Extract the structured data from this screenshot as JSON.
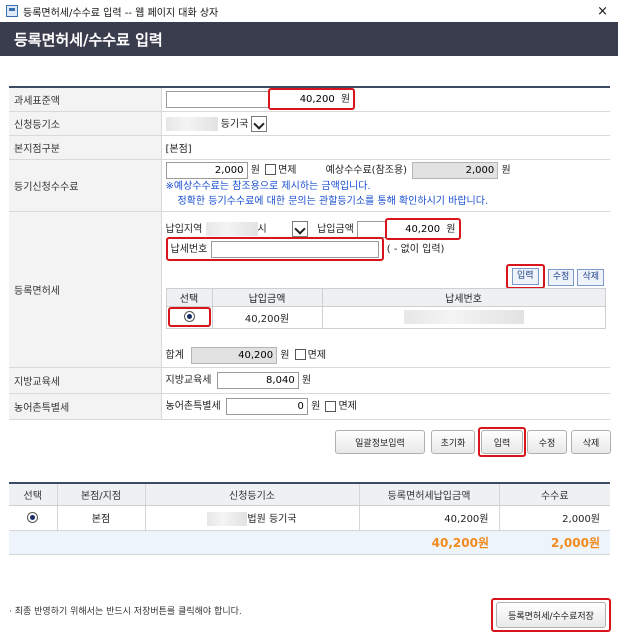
{
  "window": {
    "title": "등록면허세/수수료 입력 -- 웹 페이지 대화 상자",
    "close": "×"
  },
  "header": {
    "title": "등록면허세/수수료 입력"
  },
  "form": {
    "tax_base": {
      "label": "과세표준액",
      "value": "40,200",
      "unit": "원"
    },
    "registry": {
      "label": "신청등기소",
      "suffix": "등기국"
    },
    "branch": {
      "label": "본지점구분",
      "value": "[본점]"
    },
    "fee": {
      "label": "등기신청수수료",
      "value": "2,000",
      "unit": "원",
      "exempt": "면제",
      "expected_label": "예상수수료(참조용)",
      "expected_value": "2,000",
      "expected_unit": "원",
      "note1": "※예상수수료는 참조용으로 제시하는 금액입니다.",
      "note2": "정확한 등기수수료에 대한 문의는 관할등기소를 통해 확인하시기 바랍니다."
    },
    "license_tax": {
      "label": "등록면허세",
      "region_label": "납입지역",
      "region_suffix": "시",
      "amount_label": "납입금액",
      "amount_value": "40,200",
      "amount_unit": "원",
      "taxno_label": "납세번호",
      "taxno_hint": "( - 없이 입력)",
      "btn_input": "입력",
      "btn_edit": "수정",
      "btn_delete": "삭제",
      "table_headers": [
        "선택",
        "납입금액",
        "납세번호"
      ],
      "table_row_amount": "40,200원",
      "sum_label": "합계",
      "sum_value": "40,200",
      "sum_unit": "원",
      "sum_exempt": "면제"
    },
    "local_edu": {
      "label": "지방교육세",
      "inner_label": "지방교육세",
      "value": "8,040",
      "unit": "원"
    },
    "rural": {
      "label": "농어촌특별세",
      "inner_label": "농어촌특별세",
      "value": "0",
      "unit": "원",
      "exempt": "면제"
    }
  },
  "actions": {
    "bulk": "일괄정보입력",
    "reset": "초기화",
    "input": "입력",
    "edit": "수정",
    "delete": "삭제"
  },
  "list": {
    "headers": [
      "선택",
      "본점/지점",
      "신청등기소",
      "등록면허세납입금액",
      "수수료"
    ],
    "row": {
      "branch": "본점",
      "registry_suffix": "법원 등기국",
      "amount": "40,200원",
      "fee": "2,000원"
    },
    "total_amount": "40,200원",
    "total_fee": "2,000원"
  },
  "footer": {
    "note": "· 최종 반영하기 위해서는 반드시 저장버튼를 클릭해야 합니다.",
    "save": "등록면허세/수수료저장"
  }
}
